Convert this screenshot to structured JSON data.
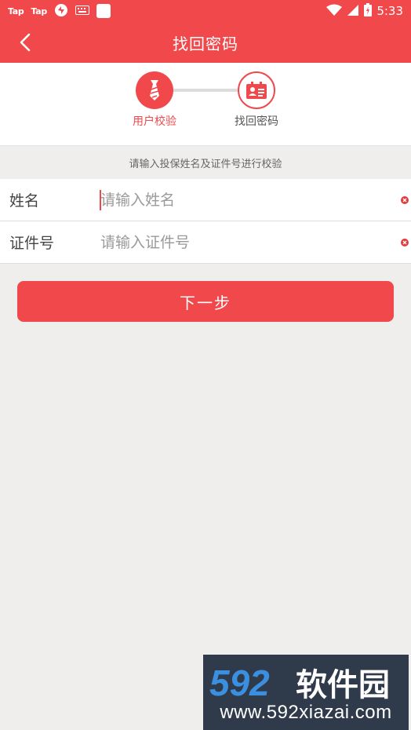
{
  "status_bar": {
    "left_texts": [
      "Tap",
      "Tap"
    ],
    "time": "5:33"
  },
  "header": {
    "title": "找回密码"
  },
  "steps": [
    {
      "label": "用户校验",
      "active": true
    },
    {
      "label": "找回密码",
      "active": false
    }
  ],
  "hint": "请输入投保姓名及证件号进行校验",
  "form": {
    "name": {
      "label": "姓名",
      "placeholder": "请输入姓名",
      "value": ""
    },
    "id": {
      "label": "证件号",
      "placeholder": "请输入证件号",
      "value": ""
    }
  },
  "next_label": "下一步",
  "watermark": {
    "brand": "592软件园",
    "url": "www.592xiazai.com"
  },
  "colors": {
    "accent": "#f0484b",
    "background": "#efeeec"
  }
}
